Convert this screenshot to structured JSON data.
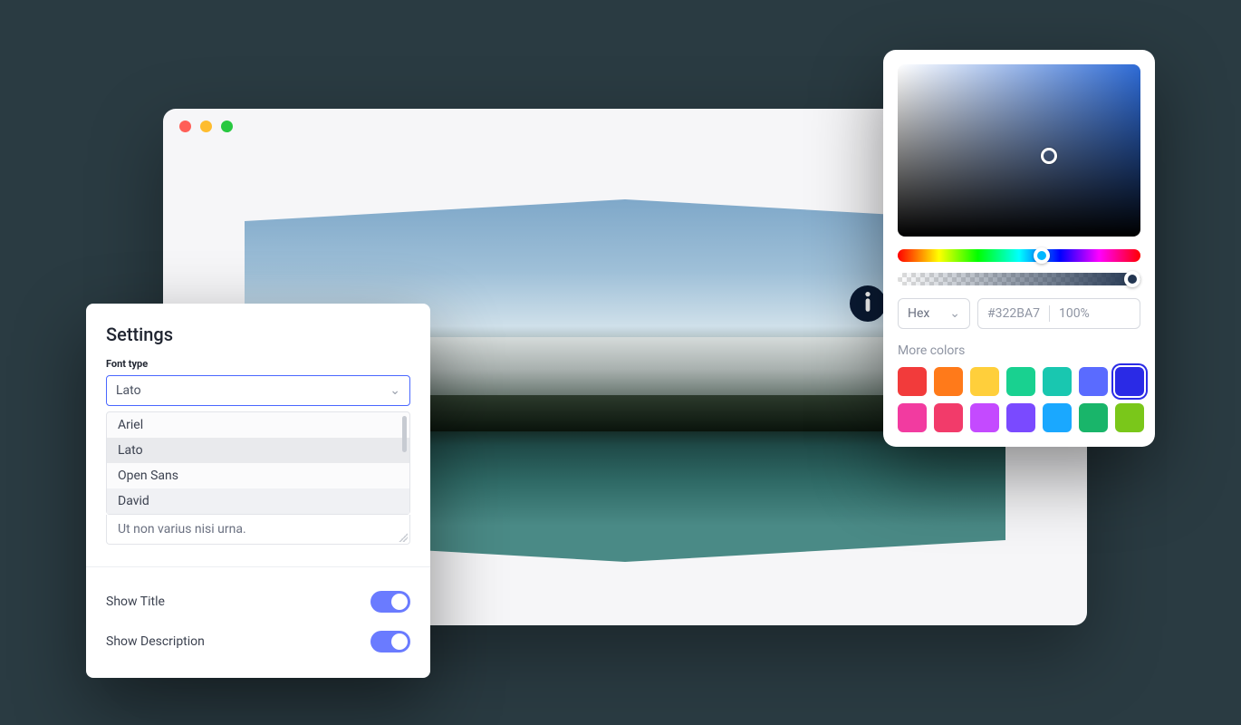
{
  "settings": {
    "title": "Settings",
    "font_type_label": "Font type",
    "selected_font": "Lato",
    "font_options": [
      "Ariel",
      "Lato",
      "Open Sans",
      "David"
    ],
    "sample_text": "Ut non varius nisi urna.",
    "toggles": {
      "show_title": {
        "label": "Show Title",
        "on": true
      },
      "show_description": {
        "label": "Show Description",
        "on": true
      }
    }
  },
  "color_picker": {
    "format": "Hex",
    "hex_value": "#322BA7",
    "opacity": "100%",
    "more_colors_label": "More colors",
    "swatches_row1": [
      "#f23b3b",
      "#ff7a1a",
      "#ffcf3b",
      "#19d190",
      "#19c7b0",
      "#5a6bff",
      "#2a2ae6"
    ],
    "swatches_row2": [
      "#f23ba0",
      "#f23b6a",
      "#c44aff",
      "#7a4aff",
      "#1aa8ff",
      "#19b56a",
      "#7ac71a"
    ],
    "selected_swatch_index": 6
  },
  "icons": {
    "info": "info-icon",
    "chevron_down": "chevron-down-icon"
  }
}
